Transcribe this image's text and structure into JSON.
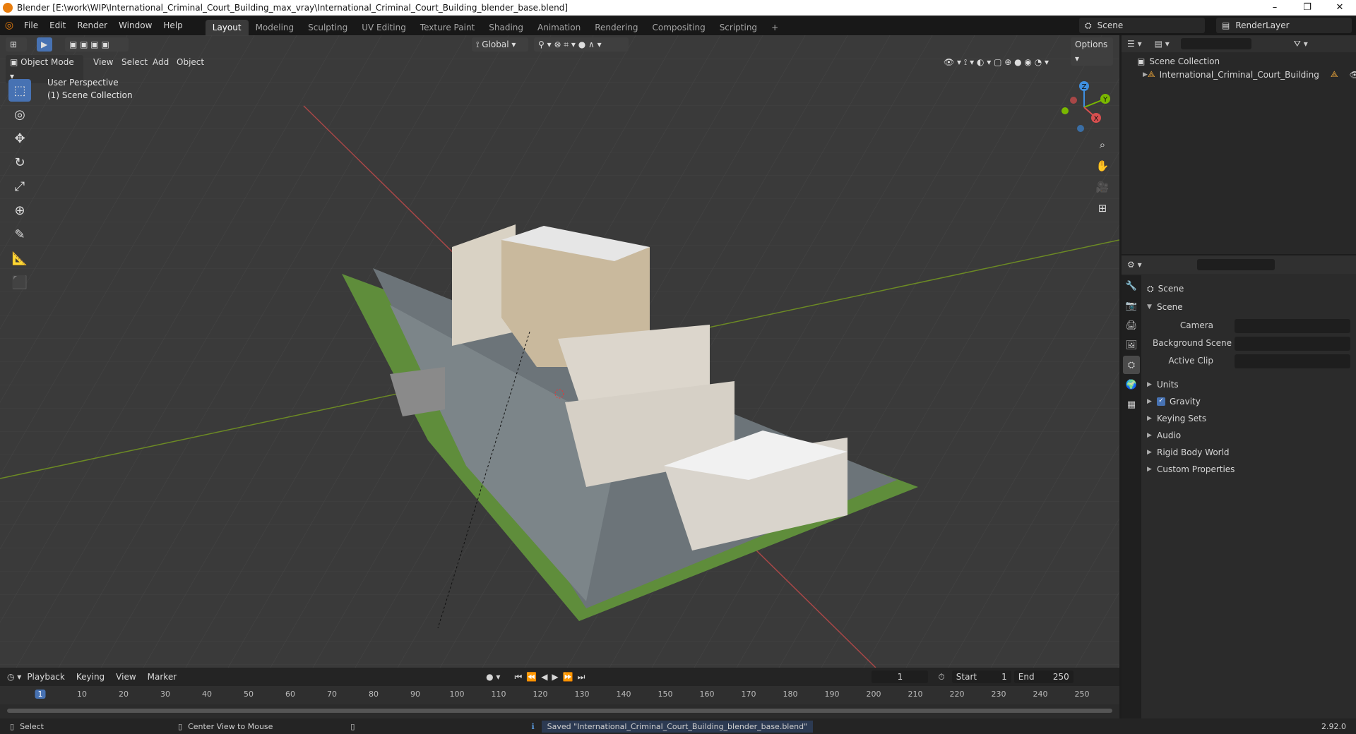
{
  "window": {
    "title": "Blender [E:\\work\\WIP\\International_Criminal_Court_Building_max_vray\\International_Criminal_Court_Building_blender_base.blend]",
    "buttons": [
      "–",
      "❐",
      "✕"
    ]
  },
  "menu": [
    "File",
    "Edit",
    "Render",
    "Window",
    "Help"
  ],
  "workspaces": [
    "Layout",
    "Modeling",
    "Sculpting",
    "UV Editing",
    "Texture Paint",
    "Shading",
    "Animation",
    "Rendering",
    "Compositing",
    "Scripting"
  ],
  "active_workspace": "Layout",
  "scene_selector": {
    "value": "Scene"
  },
  "render_layer_selector": {
    "value": "RenderLayer"
  },
  "viewport_header": {
    "transform_orientation": "Global",
    "options_label": "Options",
    "mode": "Object Mode",
    "menus": [
      "View",
      "Select",
      "Add",
      "Object"
    ]
  },
  "viewport_overlay": {
    "line1": "User Perspective",
    "line2": "(1) Scene Collection"
  },
  "gizmo": {
    "x": "X",
    "y": "Y",
    "z": "Z"
  },
  "tools": [
    "select-box",
    "cursor",
    "move",
    "rotate",
    "scale",
    "transform",
    "annotate",
    "measure",
    "add-cube"
  ],
  "outliner": {
    "root": "Scene Collection",
    "items": [
      "International_Criminal_Court_Building"
    ]
  },
  "properties": {
    "context": "Scene",
    "panel": "Scene",
    "fields": {
      "camera_label": "Camera",
      "background_label": "Background Scene",
      "clip_label": "Active Clip"
    },
    "subpanels": [
      "Units",
      "Gravity",
      "Keying Sets",
      "Audio",
      "Rigid Body World",
      "Custom Properties"
    ],
    "gravity_checked": true
  },
  "timeline": {
    "menus": [
      "Playback",
      "Keying",
      "View",
      "Marker"
    ],
    "current_frame": "1",
    "start_label": "Start",
    "start_value": "1",
    "end_label": "End",
    "end_value": "250",
    "ruler_labels": [
      "1",
      "10",
      "20",
      "30",
      "40",
      "50",
      "60",
      "70",
      "80",
      "90",
      "100",
      "110",
      "120",
      "130",
      "140",
      "150",
      "160",
      "170",
      "180",
      "190",
      "200",
      "210",
      "220",
      "230",
      "240",
      "250"
    ]
  },
  "statusbar": {
    "left": "Select",
    "middle": "Center View to Mouse",
    "message": "Saved \"International_Criminal_Court_Building_blender_base.blend\"",
    "version": "2.92.0"
  },
  "colors": {
    "accent": "#4772b3",
    "x_axis": "#d74f4f",
    "y_axis": "#7ab800",
    "z_axis": "#3f8fe0"
  }
}
